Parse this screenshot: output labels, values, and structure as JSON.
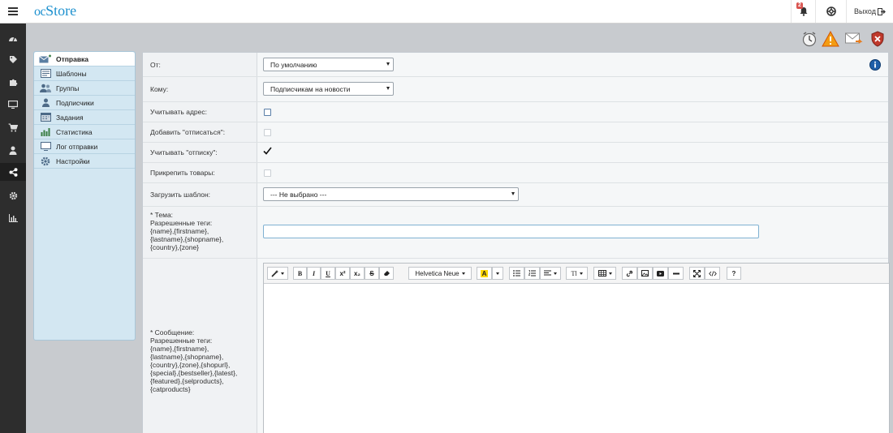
{
  "header": {
    "logo_prefix": "oc",
    "logo_name": "Store",
    "notifications_count": "2",
    "logout_label": "Выход"
  },
  "sidebar_icons": [
    "dashboard-icon",
    "tag-icon",
    "puzzle-icon",
    "monitor-icon",
    "cart-icon",
    "user-icon",
    "share-icon",
    "gear-icon",
    "bar-chart-icon"
  ],
  "toolbar_icons": [
    "clock-icon",
    "warning-icon",
    "envelope-send-icon",
    "shield-close-icon"
  ],
  "subnav": {
    "items": [
      {
        "label": "Отправка",
        "icon": "mail-send-icon",
        "active": true
      },
      {
        "label": "Шаблоны",
        "icon": "template-icon"
      },
      {
        "label": "Группы",
        "icon": "users-icon"
      },
      {
        "label": "Подписчики",
        "icon": "user-icon"
      },
      {
        "label": "Задания",
        "icon": "tasks-icon"
      },
      {
        "label": "Статистика",
        "icon": "stats-icon"
      },
      {
        "label": "Лог отправки",
        "icon": "log-icon"
      },
      {
        "label": "Настройки",
        "icon": "gear-icon"
      }
    ]
  },
  "form": {
    "from_label": "От:",
    "from_value": "По умолчанию",
    "to_label": "Кому:",
    "to_value": "Подписчикам на новости",
    "address_label": "Учитывать адрес:",
    "unsub_add_label": "Добавить \"отписаться\":",
    "unsub_count_label": "Учитывать \"отписку\":",
    "attach_label": "Прикрепить товары:",
    "template_label": "Загрузить шаблон:",
    "template_value": "--- Не выбрано ---",
    "subject_label_lines": [
      "* Тема:",
      "Разрешенные теги:",
      "{name},{firstname},",
      "{lastname},{shopname},",
      "{country},{zone}"
    ],
    "message_label_lines": [
      "* Сообщение:",
      "Разрешенные теги:",
      "{name},{firstname},",
      "{lastname},{shopname},",
      "{country},{zone},{shopurl},",
      "{special},{bestseller},{latest},",
      "{featured},{selproducts},",
      "{catproducts}"
    ],
    "subject_value": "",
    "address_checked": false,
    "unsub_add_checked": false,
    "unsub_count_checked": true,
    "attach_checked": false
  },
  "editor": {
    "font_name": "Helvetica Neue",
    "bold": "B",
    "italic": "I",
    "underline": "U",
    "superscript": "x²",
    "subscript": "x₂",
    "strike": "S",
    "color": "A",
    "fontsize": "Tl",
    "help": "?"
  }
}
